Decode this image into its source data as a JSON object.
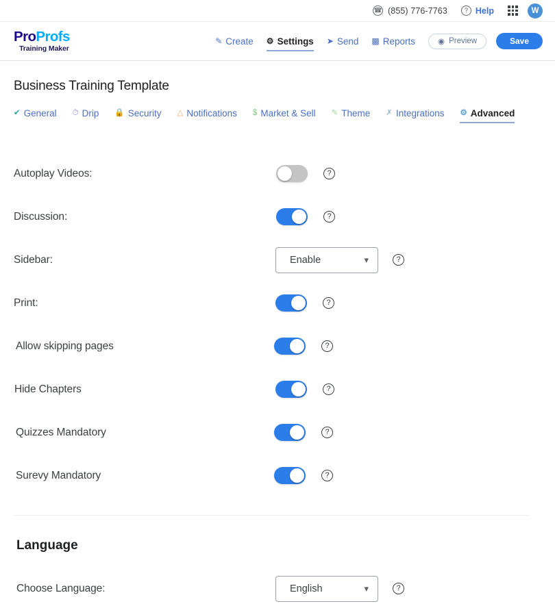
{
  "utility_bar": {
    "phone_icon": "phone-icon",
    "phone": "(855) 776-7763",
    "help_icon": "question-circle-icon",
    "help_label": "Help",
    "apps_icon": "apps-grid-icon",
    "avatar_initial": "W"
  },
  "brand": {
    "name_part1": "Pro",
    "name_part2": "Profs",
    "tagline": "Training Maker",
    "color_dark": "#1a0a8c",
    "color_light": "#00aaff"
  },
  "header_nav": {
    "items": [
      {
        "label": "Create",
        "icon": "pencil-icon",
        "active": false
      },
      {
        "label": "Settings",
        "icon": "gear-icon",
        "active": true
      },
      {
        "label": "Send",
        "icon": "send-icon",
        "active": false
      },
      {
        "label": "Reports",
        "icon": "bar-chart-icon",
        "active": false
      }
    ],
    "preview_label": "Preview",
    "preview_icon": "eye-icon",
    "save_label": "Save",
    "save_color": "#2b7de9"
  },
  "page": {
    "title": "Business Training Template"
  },
  "tabs": [
    {
      "label": "General",
      "icon": "check-circle-icon",
      "icon_color": "#2aa198",
      "active": false
    },
    {
      "label": "Drip",
      "icon": "clock-icon",
      "icon_color": "#9b8ad4",
      "active": false
    },
    {
      "label": "Security",
      "icon": "lock-icon",
      "icon_color": "#f0876b",
      "active": false
    },
    {
      "label": "Notifications",
      "icon": "bell-icon",
      "icon_color": "#f3a86b",
      "active": false
    },
    {
      "label": "Market & Sell",
      "icon": "dollar-icon",
      "icon_color": "#7fc77f",
      "active": false
    },
    {
      "label": "Theme",
      "icon": "paintbrush-icon",
      "icon_color": "#9fd3a0",
      "active": false
    },
    {
      "label": "Integrations",
      "icon": "scissors-icon",
      "icon_color": "#9ab7d8",
      "active": false
    },
    {
      "label": "Advanced",
      "icon": "gears-icon",
      "icon_color": "#5a9fd4",
      "active": true
    }
  ],
  "settings": {
    "help_icon": "question-circle-icon",
    "chevron_icon": "chevron-down-icon",
    "rows": [
      {
        "label": "Autoplay Videos:",
        "type": "toggle",
        "state": "off",
        "indent": 0
      },
      {
        "label": "Discussion:",
        "type": "toggle",
        "state": "on",
        "indent": 0
      },
      {
        "label": "Sidebar:",
        "type": "select",
        "value": "Enable",
        "indent": 0
      },
      {
        "label": "Print:",
        "type": "toggle",
        "state": "on",
        "indent": 1
      },
      {
        "label": "Allow skipping pages",
        "type": "toggle",
        "state": "on",
        "indent": 2
      },
      {
        "label": "Hide Chapters",
        "type": "toggle",
        "state": "on",
        "indent": 1
      },
      {
        "label": "Quizzes Mandatory",
        "type": "toggle",
        "state": "on",
        "indent": 2
      },
      {
        "label": "Surevy Mandatory",
        "type": "toggle",
        "state": "on",
        "indent": 2
      }
    ]
  },
  "language_section": {
    "title": "Language",
    "label": "Choose Language:",
    "value": "English",
    "chevron_icon": "chevron-down-icon",
    "help_icon": "question-circle-icon"
  }
}
